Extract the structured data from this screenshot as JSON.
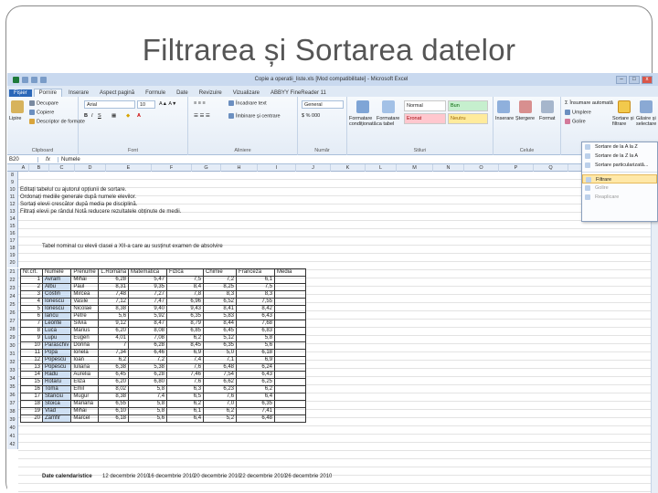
{
  "slide": {
    "title": "Filtrarea și Sortarea datelor"
  },
  "window": {
    "title": "Copie a operatii_liste.xls [Mod compatibilitate] - Microsoft Excel",
    "min": "–",
    "max": "□",
    "close": "x"
  },
  "ribbon_tabs": [
    "Fișier",
    "Pornire",
    "Inserare",
    "Aspect pagină",
    "Formule",
    "Date",
    "Revizuire",
    "Vizualizare",
    "ABBYY FineReader 11"
  ],
  "ribbon": {
    "clipboard": {
      "paste": "Lipire",
      "cut": "Decupare",
      "copy": "Copiere",
      "painter": "Descriptor de formate",
      "label": "Clipboard"
    },
    "font": {
      "family": "Arial",
      "size": "10",
      "label": "Font"
    },
    "align": {
      "wrap": "Încadrare text",
      "merge": "Îmbinare și centrare",
      "label": "Aliniere"
    },
    "number": {
      "format": "General",
      "label": "Număr"
    },
    "styles": {
      "cond": "Formatare condiționată",
      "table": "Formatare ca tabel",
      "normal": "Normal",
      "bun": "Bun",
      "eronat": "Eronat",
      "neutru": "Neutru",
      "label": "Stiluri"
    },
    "cells": {
      "insert": "Inserare",
      "delete": "Ștergere",
      "format": "Format",
      "label": "Celule"
    },
    "editing": {
      "sum": "Însumare automată",
      "fill": "Umplere",
      "clear": "Golire",
      "sort": "Sortare și filtrare",
      "find": "Găsire și selectare"
    }
  },
  "dropdown": {
    "items": [
      "Sortare de la A la Z",
      "Sortare de la Z la A",
      "Sortare particularizată...",
      "Filtrare",
      "Golire",
      "Reaplicare"
    ]
  },
  "formula_bar": {
    "name_box": "B20",
    "fx": "fx",
    "value": "Numele"
  },
  "columns": [
    "A",
    "B",
    "C",
    "D",
    "E",
    "F",
    "G",
    "H",
    "I",
    "J",
    "K",
    "L",
    "M",
    "N",
    "O",
    "P",
    "Q",
    "R",
    "S"
  ],
  "notes": [
    "Editați tabelul cu ajutorul opțiunii de sortare.",
    "Ordonați mediile generale după numele elevilor.",
    "Sortați elevii crescător după media pe disciplină.",
    "Filtrați elevii pe rândul Notă reducere rezultatele obținute de medii."
  ],
  "table_title": "Tabel nominal cu elevii clasei a XII-a care au susținut examen de absolvire",
  "header": [
    "Nr.crt.",
    "Numele",
    "Prenume",
    "L.Română",
    "Matematică",
    "Fizica",
    "Chimie",
    "Franceză",
    "Media"
  ],
  "rows": [
    [
      "1",
      "Avram",
      "Mihai",
      "6,28",
      "5,47",
      "7,5",
      "7,2",
      "6,1"
    ],
    [
      "2",
      "Albu",
      "Paul",
      "8,31",
      "9,35",
      "8,4",
      "8,25",
      "7,5"
    ],
    [
      "3",
      "Costin",
      "Mircea",
      "7,48",
      "7,27",
      "7,8",
      "8,3",
      "8,3"
    ],
    [
      "4",
      "Ionescu",
      "Vasile",
      "7,12",
      "7,47",
      "6,96",
      "6,52",
      "7,55"
    ],
    [
      "5",
      "Ionescu",
      "Nicolae",
      "8,38",
      "9,40",
      "9,43",
      "8,41",
      "8,42"
    ],
    [
      "6",
      "Iancu",
      "Petre",
      "5,6",
      "5,92",
      "6,35",
      "5,83",
      "6,43"
    ],
    [
      "7",
      "Leonte",
      "Silvia",
      "9,12",
      "8,47",
      "8,79",
      "8,44",
      "7,68"
    ],
    [
      "8",
      "Luca",
      "Marius",
      "6,20",
      "8,08",
      "6,85",
      "6,45",
      "6,83"
    ],
    [
      "9",
      "Lupu",
      "Eugen",
      "4,01",
      "7,08",
      "6,2",
      "5,12",
      "5,8"
    ],
    [
      "10",
      "Paraschiv",
      "Dorina",
      "7",
      "6,28",
      "8,45",
      "6,35",
      "5,6"
    ],
    [
      "11",
      "Popa",
      "Ionela",
      "7,34",
      "6,46",
      "6,9",
      "5,0",
      "6,18"
    ],
    [
      "12",
      "Popescu",
      "Ioan",
      "6,2",
      "7,2",
      "7,4",
      "7,1",
      "6,9"
    ],
    [
      "13",
      "Popescu",
      "Iuliana",
      "6,38",
      "5,38",
      "7,6",
      "6,48",
      "6,24"
    ],
    [
      "14",
      "Radu",
      "Aurelia",
      "6,45",
      "6,28",
      "7,46",
      "7,54",
      "6,43"
    ],
    [
      "15",
      "Rotaru",
      "Eliza",
      "6,20",
      "6,80",
      "7,6",
      "6,62",
      "6,25"
    ],
    [
      "16",
      "Toma",
      "Emil",
      "8,02",
      "5,8",
      "6,3",
      "6,23",
      "6,2"
    ],
    [
      "17",
      "Stanciu",
      "Mugur",
      "8,38",
      "7,4",
      "6,5",
      "7,6",
      "6,4"
    ],
    [
      "18",
      "Stoica",
      "Mariana",
      "6,55",
      "5,8",
      "6,2",
      "7,0",
      "6,35"
    ],
    [
      "19",
      "Vlad",
      "Mihai",
      "6,10",
      "5,8",
      "6,1",
      "6,2",
      "7,41"
    ],
    [
      "20",
      "Zamfir",
      "Marcel",
      "6,18",
      "5,6",
      "6,4",
      "5,2",
      "6,48"
    ]
  ],
  "dates_label": "Date calendaristice",
  "dates": [
    "12 decembrie 2010",
    "16 decembrie 2010",
    "20 decembrie 2010",
    "22 decembrie 2010",
    "26 decembrie 2010"
  ],
  "row_numbers": [
    "8",
    "9",
    "10",
    "11",
    "12",
    "13",
    "14",
    "15",
    "16",
    "17",
    "18",
    "19",
    "20",
    "21",
    "22",
    "23",
    "24",
    "25",
    "26",
    "27",
    "28",
    "29",
    "30",
    "31",
    "32",
    "33",
    "34",
    "35",
    "36",
    "37",
    "38",
    "39",
    "40",
    "41",
    "42"
  ]
}
